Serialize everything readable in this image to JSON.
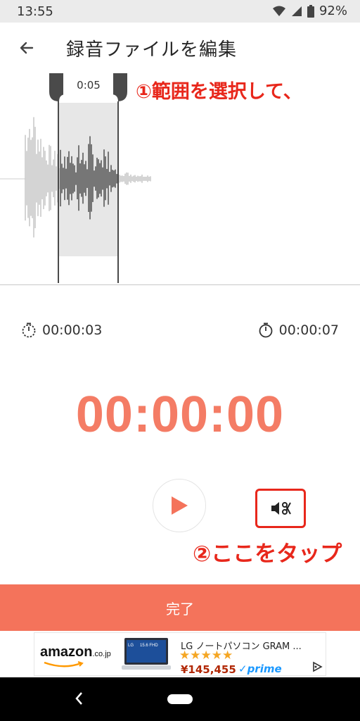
{
  "status_bar": {
    "time": "13:55",
    "battery": "92%"
  },
  "app_bar": {
    "title": "録音ファイルを編集"
  },
  "waveform": {
    "selection_duration": "0:05"
  },
  "annotations": {
    "step1": "①範囲を選択して、",
    "step2": "②ここをタップ"
  },
  "timers": {
    "start": "00:00:03",
    "end": "00:00:07",
    "current": "00:00:00"
  },
  "actions": {
    "done_label": "完了"
  },
  "ad": {
    "brand": "amazon",
    "brand_suffix": ".co.jp",
    "laptop_label": "15.6 FHD",
    "laptop_brand": "LG",
    "title": "LG ノートパソコン GRAM ...",
    "rating": 4.5,
    "stars": "★★★★★",
    "price": "¥145,455",
    "prime": "✓prime"
  },
  "colors": {
    "accent": "#f47c65",
    "annotation_red": "#e8271b",
    "done_bar": "#f4735b"
  }
}
